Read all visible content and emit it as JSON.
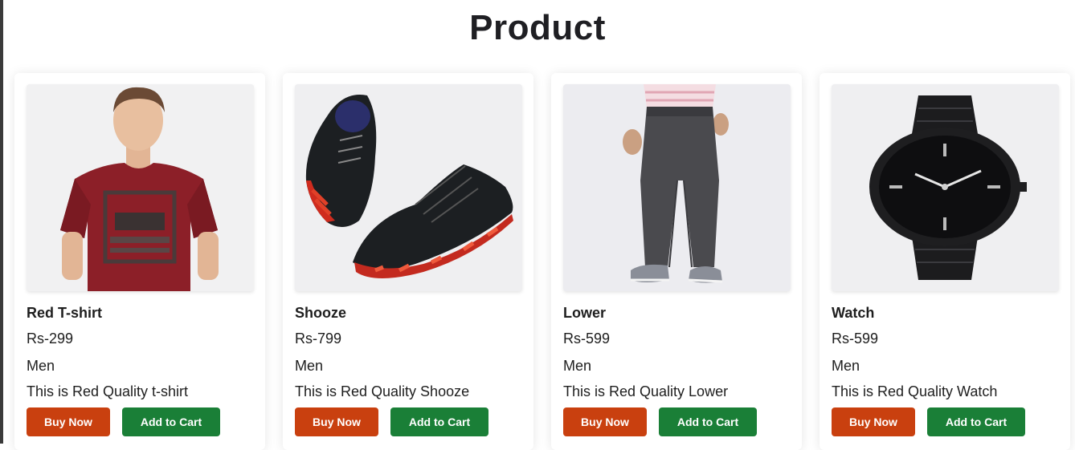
{
  "page": {
    "title": "Product"
  },
  "buttons": {
    "buy": "Buy Now",
    "cart": "Add to Cart"
  },
  "colors": {
    "buy_button": "#c9400f",
    "cart_button": "#1a7f37",
    "image_bg": "#eeeeef"
  },
  "products": [
    {
      "name": "Red T-shirt",
      "price": "Rs-299",
      "category": "Men",
      "description": "This is Red Quality t-shirt",
      "image_icon": "red-tshirt-icon"
    },
    {
      "name": "Shooze",
      "price": "Rs-799",
      "category": "Men",
      "description": "This is Red Quality Shooze",
      "image_icon": "shoes-icon"
    },
    {
      "name": "Lower",
      "price": "Rs-599",
      "category": "Men",
      "description": "This is Red Quality Lower",
      "image_icon": "trousers-icon"
    },
    {
      "name": "Watch",
      "price": "Rs-599",
      "category": "Men",
      "description": "This is Red Quality Watch",
      "image_icon": "watch-icon"
    }
  ]
}
